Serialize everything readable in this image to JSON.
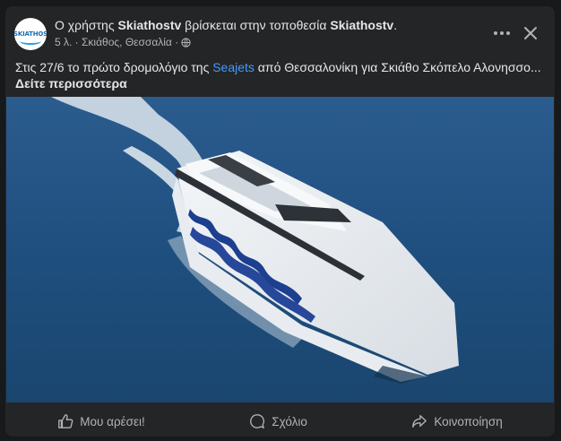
{
  "post": {
    "avatar_text": "SKIATHOS",
    "title_prefix": "Ο χρήστης ",
    "author": "Skiathostv",
    "title_middle": " βρίσκεται στην τοποθεσία ",
    "location_name": "Skiathostv",
    "title_suffix": ".",
    "meta": "5 λ. · Σκιάθος, Θεσσαλία ·",
    "caption_prefix": "Στις 27/6 το πρώτο δρομολόγιο της ",
    "caption_link": "Seajets",
    "caption_suffix": " από Θεσσαλονίκη για Σκιάθο Σκόπελο Αλονησσο... ",
    "caption_more": "Δείτε περισσότερα"
  },
  "actions": {
    "like": "Μου αρέσει!",
    "comment": "Σχόλιο",
    "share": "Κοινοποίηση"
  },
  "icons": [
    "more-icon",
    "close-icon",
    "globe-icon",
    "like-icon",
    "comment-icon",
    "share-icon"
  ]
}
